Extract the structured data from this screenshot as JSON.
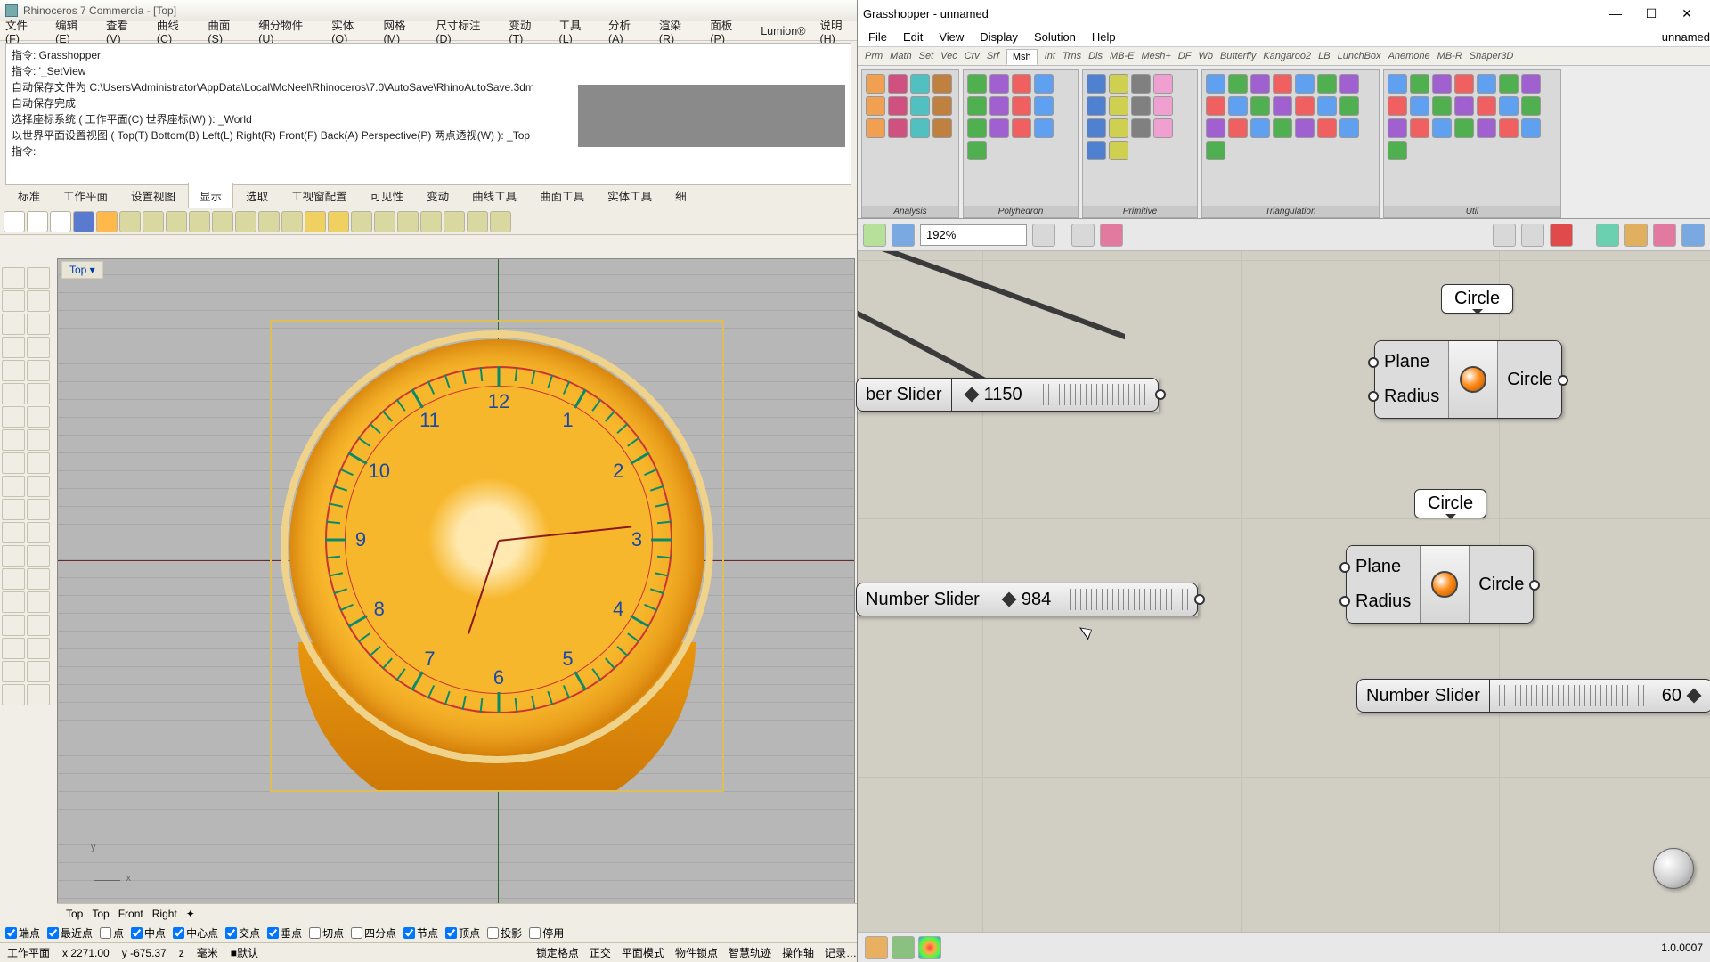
{
  "rhino": {
    "title": "Rhinoceros 7 Commercia - [Top]",
    "menu": [
      "文件(F)",
      "编辑(E)",
      "查看(V)",
      "曲线(C)",
      "曲面(S)",
      "细分物件(U)",
      "实体(O)",
      "网格(M)",
      "尺寸标注(D)",
      "变动(T)",
      "工具(L)",
      "分析(A)",
      "渲染(R)",
      "面板(P)",
      "Lumion®",
      "说明(H)"
    ],
    "cmd": [
      "指令: Grasshopper",
      "指令: '_SetView",
      "自动保存文件为 C:\\Users\\Administrator\\AppData\\Local\\McNeel\\Rhinoceros\\7.0\\AutoSave\\RhinoAutoSave.3dm",
      "自动保存完成",
      "选择座标系统 ( 工作平面(C)  世界座标(W) ): _World",
      "以世界平面设置视图 ( Top(T)  Bottom(B)  Left(L)  Right(R)  Front(F)  Back(A)  Perspective(P)  两点透视(W) ): _Top",
      "指令:"
    ],
    "tabs": [
      "标准",
      "工作平面",
      "设置视图",
      "显示",
      "选取",
      "工视窗配置",
      "可见性",
      "变动",
      "曲线工具",
      "曲面工具",
      "实体工具",
      "细"
    ],
    "tabs_active": "显示",
    "viewport_label": "Top ▾",
    "clock_numbers": [
      "12",
      "1",
      "2",
      "3",
      "4",
      "5",
      "6",
      "7",
      "8",
      "9",
      "10",
      "11"
    ],
    "axes": {
      "y": "y",
      "x": "x"
    },
    "viewtabs": [
      "Top",
      "Top",
      "Front",
      "Right",
      "✦"
    ],
    "osnaps": [
      {
        "label": "端点",
        "on": true
      },
      {
        "label": "最近点",
        "on": true
      },
      {
        "label": "点",
        "on": false
      },
      {
        "label": "中点",
        "on": true
      },
      {
        "label": "中心点",
        "on": true
      },
      {
        "label": "交点",
        "on": true
      },
      {
        "label": "垂点",
        "on": true
      },
      {
        "label": "切点",
        "on": false
      },
      {
        "label": "四分点",
        "on": false
      },
      {
        "label": "节点",
        "on": true
      },
      {
        "label": "顶点",
        "on": true
      },
      {
        "label": "投影",
        "on": false
      },
      {
        "label": "停用",
        "on": false
      }
    ],
    "status": {
      "plane": "工作平面",
      "x": "x 2271.00",
      "y": "y -675.37",
      "z": "z",
      "unit": "毫米",
      "layer": "■默认",
      "extras": [
        "锁定格点",
        "正交",
        "平面模式",
        "物件锁点",
        "智慧轨迹",
        "操作轴",
        "记录…"
      ]
    }
  },
  "gh": {
    "title": "Grasshopper - unnamed",
    "doc": "unnamed",
    "menu": [
      "File",
      "Edit",
      "View",
      "Display",
      "Solution",
      "Help"
    ],
    "plugtabs": [
      "Prm",
      "Math",
      "Set",
      "Vec",
      "Crv",
      "Srf",
      "Msh",
      "Int",
      "Trns",
      "Dis",
      "MB-E",
      "Mesh+",
      "DF",
      "Wb",
      "Butterfly",
      "Kangaroo2",
      "LB",
      "LunchBox",
      "Anemone",
      "MB-R",
      "Shaper3D"
    ],
    "plugtabs_active": "Msh",
    "shelves": [
      {
        "label": "Analysis",
        "count": 12
      },
      {
        "label": "Polyhedron",
        "count": 13
      },
      {
        "label": "Primitive",
        "count": 14
      },
      {
        "label": "Triangulation",
        "count": 22
      },
      {
        "label": "Util",
        "count": 22
      }
    ],
    "zoom": "192%",
    "nodes": {
      "circle_tag_1": "Circle",
      "circle_tag_2": "Circle",
      "comp_in_plane": "Plane",
      "comp_in_radius": "Radius",
      "comp_out": "Circle",
      "slider1_label": "ber Slider",
      "slider1_value": "1150",
      "slider2_label": "Number Slider",
      "slider2_value": "984",
      "slider3_label": "Number Slider",
      "slider3_value": "60"
    },
    "version": "1.0.0007"
  }
}
